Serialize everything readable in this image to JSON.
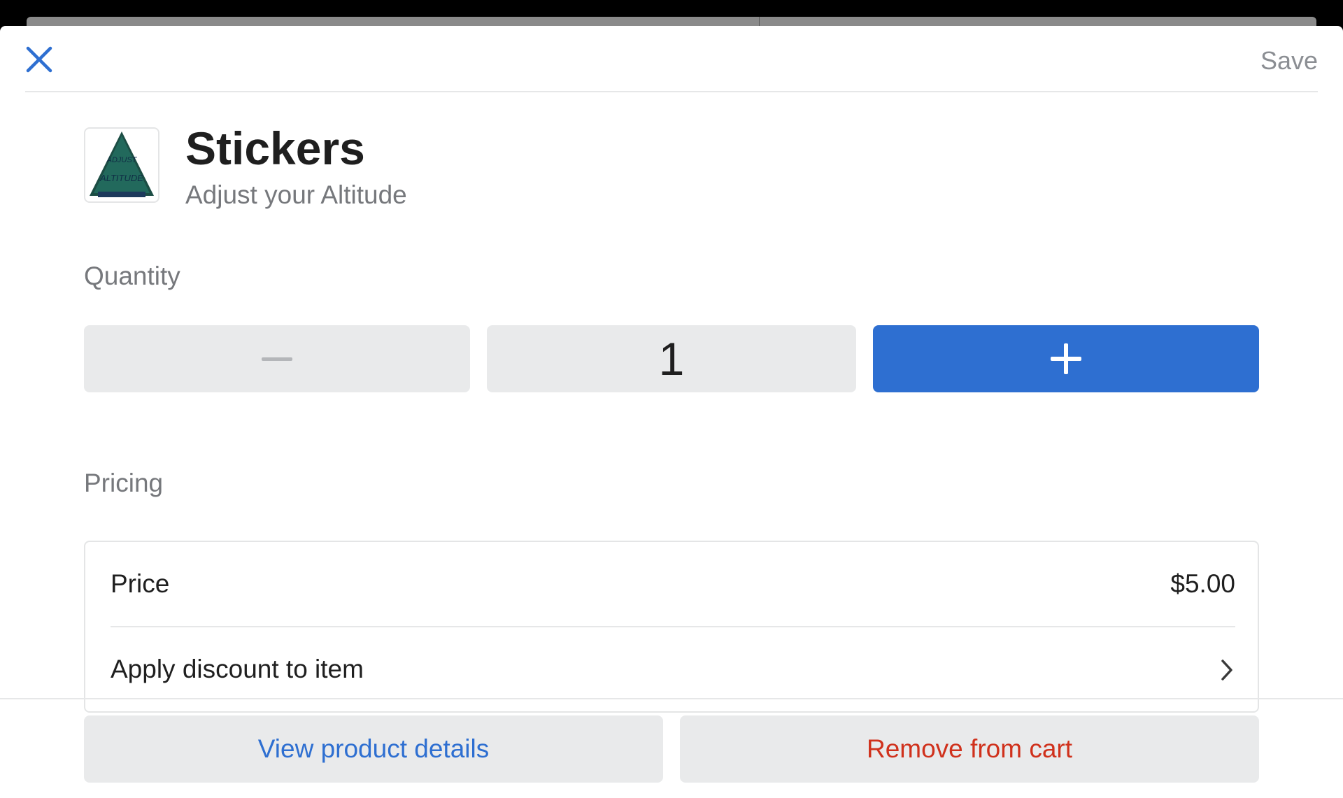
{
  "header": {
    "close_icon": "close-icon",
    "save_label": "Save"
  },
  "product": {
    "name": "Stickers",
    "variant": "Adjust your Altitude",
    "thumbnail_text": [
      "ADJUST",
      "ALTITUDE"
    ]
  },
  "quantity": {
    "label": "Quantity",
    "value": "1",
    "decrement_icon": "minus-icon",
    "increment_icon": "plus-icon"
  },
  "pricing": {
    "label": "Pricing",
    "price_label": "Price",
    "price_value": "$5.00",
    "discount_label": "Apply discount to item",
    "discount_icon": "chevron-right-icon"
  },
  "footer": {
    "view_label": "View product details",
    "remove_label": "Remove from cart"
  },
  "colors": {
    "accent": "#2e6fd1",
    "danger": "#d0311c",
    "muted": "#76787c",
    "surface": "#e9eaeb"
  }
}
